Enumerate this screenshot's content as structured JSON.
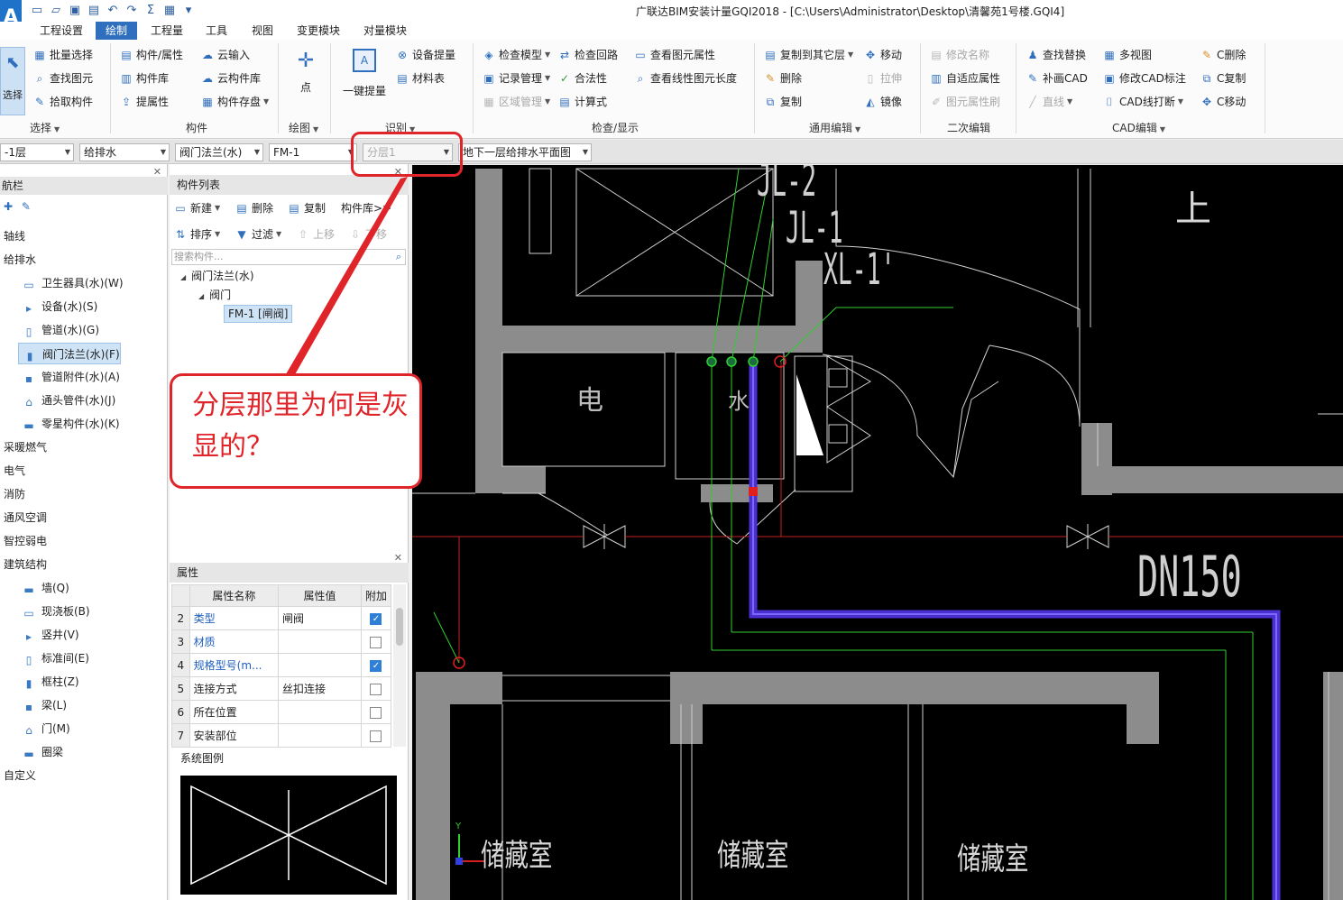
{
  "window": {
    "app_letter": "A",
    "title": "广联达BIM安装计量GQI2018 - [C:\\Users\\Administrator\\Desktop\\清馨苑1号楼.GQI4]"
  },
  "menu": {
    "tabs": [
      "工程设置",
      "绘制",
      "工程量",
      "工具",
      "视图",
      "变更模块",
      "对量模块"
    ],
    "active": "绘制"
  },
  "ribbon": {
    "select_group": {
      "big_button": "选择",
      "items": [
        "批量选择",
        "查找图元",
        "拾取构件"
      ],
      "label": "选择"
    },
    "component_group": {
      "items": [
        "构件/属性",
        "构件库",
        "提属性",
        "云输入",
        "云构件库",
        "构件存盘"
      ],
      "label": "构件"
    },
    "draw_group": {
      "big_button": "点",
      "label": "绘图"
    },
    "identify_group": {
      "big_button": "一键提量",
      "items": [
        "设备提量",
        "材料表"
      ],
      "label": "识别"
    },
    "check_group": {
      "items": [
        "检查模型",
        "记录管理",
        "区域管理",
        "检查回路",
        "合法性",
        "计算式",
        "查看图元属性",
        "查看线性图元长度"
      ],
      "label": "检查/显示"
    },
    "general_group": {
      "items": [
        "复制到其它层",
        "删除",
        "复制",
        "移动",
        "拉伸",
        "镜像"
      ],
      "label": "通用编辑"
    },
    "secondary_group": {
      "items": [
        "修改名称",
        "自适应属性",
        "图元属性刷"
      ],
      "label": "二次编辑",
      "extra": "直线"
    },
    "cad_group": {
      "items": [
        "查找替换",
        "补画CAD",
        "多视图",
        "修改CAD标注",
        "CAD线打断",
        "C删除",
        "C复制",
        "C移动"
      ],
      "label": "CAD编辑"
    }
  },
  "selectors": {
    "floor": "-1层",
    "discipline": "给排水",
    "category": "阀门法兰(水)",
    "component": "FM-1",
    "layer": "分层1",
    "drawing": "地下一层给排水平面图"
  },
  "nav": {
    "title": "航栏",
    "items": [
      {
        "label": "轴线",
        "level": 0
      },
      {
        "label": "给排水",
        "level": 0
      },
      {
        "label": "卫生器具(水)(W)",
        "level": 1
      },
      {
        "label": "设备(水)(S)",
        "level": 1
      },
      {
        "label": "管道(水)(G)",
        "level": 1
      },
      {
        "label": "阀门法兰(水)(F)",
        "level": 1,
        "selected": true
      },
      {
        "label": "管道附件(水)(A)",
        "level": 1
      },
      {
        "label": "通头管件(水)(J)",
        "level": 1
      },
      {
        "label": "零星构件(水)(K)",
        "level": 1
      },
      {
        "label": "采暖燃气",
        "level": 0
      },
      {
        "label": "电气",
        "level": 0
      },
      {
        "label": "消防",
        "level": 0
      },
      {
        "label": "通风空调",
        "level": 0
      },
      {
        "label": "智控弱电",
        "level": 0
      },
      {
        "label": "建筑结构",
        "level": 0
      },
      {
        "label": "墙(Q)",
        "level": 1
      },
      {
        "label": "现浇板(B)",
        "level": 1
      },
      {
        "label": "竖井(V)",
        "level": 1
      },
      {
        "label": "标准间(E)",
        "level": 1
      },
      {
        "label": "框柱(Z)",
        "level": 1
      },
      {
        "label": "梁(L)",
        "level": 1
      },
      {
        "label": "门(M)",
        "level": 1
      },
      {
        "label": "圈梁",
        "level": 1
      },
      {
        "label": "自定义",
        "level": 0
      }
    ]
  },
  "component_list": {
    "title": "构件列表",
    "toolbar": [
      "新建",
      "删除",
      "复制",
      "构件库>>",
      "排序",
      "过滤",
      "上移",
      "下移"
    ],
    "search_placeholder": "搜索构件...",
    "tree": [
      "阀门法兰(水)",
      "阀门",
      "FM-1 [闸阀]"
    ]
  },
  "properties": {
    "title": "属性",
    "headers": [
      "属性名称",
      "属性值",
      "附加"
    ],
    "rows": [
      {
        "num": "2",
        "name": "类型",
        "value": "闸阀",
        "checked": true,
        "blue": true
      },
      {
        "num": "3",
        "name": "材质",
        "value": "",
        "checked": false,
        "blue": true
      },
      {
        "num": "4",
        "name": "规格型号(m...",
        "value": "",
        "checked": true,
        "blue": true
      },
      {
        "num": "5",
        "name": "连接方式",
        "value": "丝扣连接",
        "checked": false,
        "blue": false
      },
      {
        "num": "6",
        "name": "所在位置",
        "value": "",
        "checked": false,
        "blue": false
      },
      {
        "num": "7",
        "name": "安装部位",
        "value": "",
        "checked": false,
        "blue": false
      }
    ],
    "legend_title": "系统图例"
  },
  "cad": {
    "labels": {
      "jl2": "JL-2",
      "jl1": "JL-1",
      "xl1": "XL-1'",
      "up": "上",
      "elec": "电",
      "water": "水",
      "dn": "DN150",
      "store1": "储藏室",
      "store2": "储藏室",
      "store3": "储藏室",
      "axis_y": "Y"
    },
    "colors": {
      "wall": "#8c8c8c",
      "pipe": "#4b2fd0",
      "green": "#2fd02f",
      "red": "#e02020"
    }
  },
  "annotation": {
    "text": "分层那里为何是灰显的？",
    "color": "#e0252a"
  }
}
